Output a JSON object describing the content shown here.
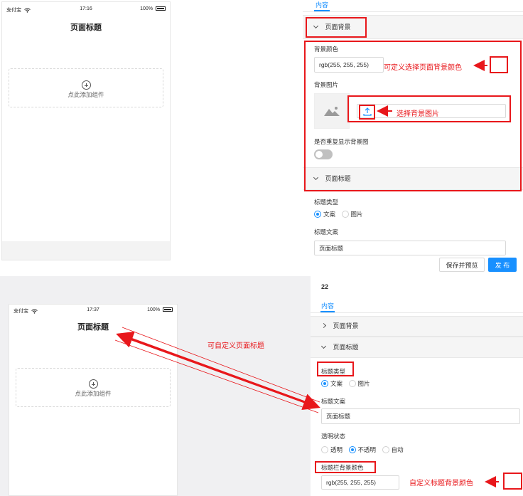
{
  "top": {
    "phone": {
      "carrier": "支付宝",
      "time": "17:16",
      "battery": "100%",
      "title": "页面标题",
      "add_component": "点此添加组件"
    },
    "panel": {
      "tab": "内容",
      "sections": {
        "background": "页面背景",
        "title": "页面标题"
      },
      "bg_color_label": "背景颜色",
      "bg_color_value": "rgb(255, 255, 255)",
      "bg_image_label": "背景图片",
      "repeat_label": "是否重复显示背景图",
      "title_type_label": "标题类型",
      "title_type_options": [
        "文案",
        "图片"
      ],
      "title_text_label": "标题文案",
      "title_text_value": "页面标题",
      "save_preview": "保存并预览",
      "publish": "发 布"
    },
    "annotations": {
      "color": "可定义选择页面背景颜色",
      "image": "选择背景图片"
    }
  },
  "bottom": {
    "phone": {
      "carrier": "支付宝",
      "time": "17:37",
      "battery": "100%",
      "title": "页面标题",
      "add_component": "点此添加组件"
    },
    "panel": {
      "number": "22",
      "tab": "内容",
      "sections": {
        "background": "页面背景",
        "title": "页面标题"
      },
      "title_type_label": "标题类型",
      "title_type_options": [
        "文案",
        "图片"
      ],
      "title_text_label": "标题文案",
      "title_text_value": "页面标题",
      "transparency_label": "透明状态",
      "transparency_options": [
        "透明",
        "不透明",
        "自动"
      ],
      "titlebar_color_label": "标题栏背景颜色",
      "titlebar_color_value": "rgb(255, 255, 255)"
    },
    "annotations": {
      "custom_title": "可自定义页面标题",
      "custom_color": "自定义标题背景颜色"
    }
  },
  "colors": {
    "accent": "#1890ff",
    "annotation": "#e8171b",
    "bottom_bg": "#f0f0f2"
  },
  "icons": {
    "wifi": "wifi-icon",
    "battery": "battery-icon",
    "plus": "plus-circle-icon",
    "image": "image-placeholder-icon",
    "upload": "upload-icon",
    "chevron": "chevron-icon"
  }
}
